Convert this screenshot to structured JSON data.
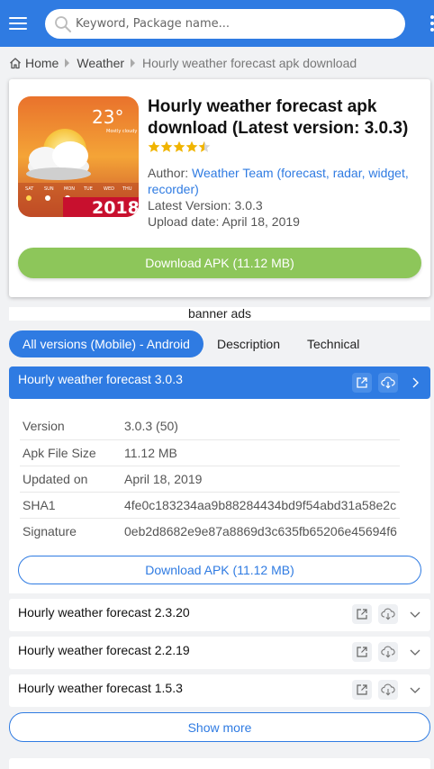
{
  "header": {
    "search_placeholder": "Keyword, Package name..."
  },
  "breadcrumb": {
    "home": "Home",
    "category": "Weather",
    "current": "Hourly weather forecast apk download"
  },
  "app": {
    "title": "Hourly weather forecast apk download (Latest version: 3.0.3)",
    "rating_stars": 4.5,
    "author_label": "Author:",
    "author_name": "Weather Team (forecast, radar, widget, recorder)",
    "latest_version_label": "Latest Version:",
    "latest_version": "3.0.3",
    "upload_date_label": "Upload date:",
    "upload_date": "April 18, 2019",
    "download_label": "Download APK (11.12 MB)",
    "icon": {
      "temp": "23°",
      "badge": "Mostly cloudy",
      "days": [
        "SAT",
        "SUN",
        "MON",
        "TUE",
        "WED",
        "THU"
      ],
      "year": "2018"
    }
  },
  "ads": "banner ads",
  "tabs": [
    {
      "label": "All versions (Mobile) - Android",
      "active": true
    },
    {
      "label": "Description",
      "active": false
    },
    {
      "label": "Technical",
      "active": false
    }
  ],
  "versions": {
    "expanded": {
      "title": "Hourly weather forecast 3.0.3",
      "details": [
        {
          "key": "Version",
          "value": "3.0.3 (50)"
        },
        {
          "key": "Apk File Size",
          "value": "11.12 MB"
        },
        {
          "key": "Updated on",
          "value": "April 18, 2019"
        },
        {
          "key": "SHA1",
          "value": "4fe0c183234aa9b88284434bd9f54abd31a58e2c"
        },
        {
          "key": "Signature",
          "value": "0eb2d8682e9e87a8869d3c635fb65206e45694f6"
        }
      ],
      "download_label": "Download APK (11.12 MB)"
    },
    "collapsed": [
      {
        "title": "Hourly weather forecast 2.3.20"
      },
      {
        "title": "Hourly weather forecast 2.2.19"
      },
      {
        "title": "Hourly weather forecast 1.5.3"
      }
    ],
    "show_more": "Show more"
  },
  "colors": {
    "primary": "#2f7be2",
    "download_green": "#8dc65a",
    "star": "#f0b400"
  }
}
